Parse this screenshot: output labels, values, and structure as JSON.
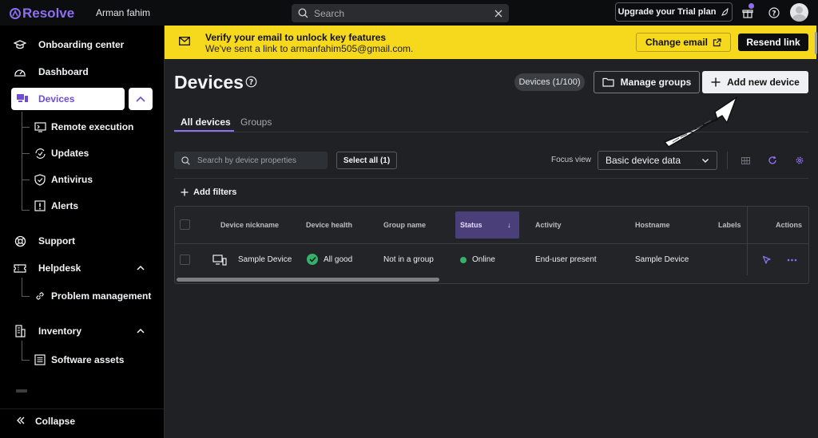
{
  "app": {
    "brand": "Resolve",
    "user_name": "Arman fahim"
  },
  "search": {
    "placeholder": "Search"
  },
  "topbar": {
    "upgrade_label": "Upgrade your Trial plan"
  },
  "sidebar": {
    "onboarding": "Onboarding center",
    "dashboard": "Dashboard",
    "devices": "Devices",
    "devices_sub": [
      "Remote execution",
      "Updates",
      "Antivirus",
      "Alerts"
    ],
    "support": "Support",
    "helpdesk": "Helpdesk",
    "helpdesk_sub": [
      "Problem management"
    ],
    "inventory": "Inventory",
    "inventory_sub": [
      "Software assets"
    ],
    "collapse": "Collapse"
  },
  "banner": {
    "title": "Verify your email to unlock key features",
    "message": "We've sent a link to armanfahim505@gmail.com.",
    "change_email": "Change email",
    "resend": "Resend link"
  },
  "page": {
    "title": "Devices",
    "devices_badge": "Devices (1/100)",
    "manage_groups": "Manage groups",
    "add_device": "Add new device"
  },
  "tabs": [
    "All devices",
    "Groups"
  ],
  "toolbar": {
    "search_placeholder": "Search by device properties",
    "select_all": "Select all (1)",
    "focus_label": "Focus view",
    "focus_value": "Basic device data",
    "add_filters": "Add filters"
  },
  "table": {
    "columns": [
      "Device nickname",
      "Device health",
      "Group name",
      "Status",
      "Activity",
      "Hostname",
      "Labels",
      "Actions"
    ],
    "sort_indicator": "↓",
    "rows": [
      {
        "nickname": "Sample Device",
        "health": "All good",
        "group": "Not in a group",
        "status": "Online",
        "activity": "End-user present",
        "hostname": "Sample Device",
        "labels": ""
      }
    ]
  },
  "colors": {
    "accent": "#8f6ef0",
    "banner": "#f6d81d",
    "online": "#33b26a"
  }
}
